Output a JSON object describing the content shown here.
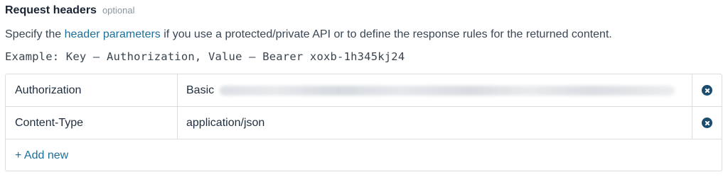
{
  "section": {
    "title": "Request headers",
    "optional_label": "optional"
  },
  "description": {
    "prefix": "Specify the ",
    "link_text": "header parameters",
    "suffix": " if you use a protected/private API or to define the response rules for the returned content."
  },
  "example_text": "Example: Key – Authorization, Value – Bearer xoxb-1h345kj24",
  "headers": [
    {
      "key": "Authorization",
      "value": "Basic",
      "value_redacted": true
    },
    {
      "key": "Content-Type",
      "value": "application/json",
      "value_redacted": false
    }
  ],
  "actions": {
    "remove_icon": "close-circle-icon",
    "add_new_label": "+ Add new"
  },
  "colors": {
    "link": "#1d6f99",
    "remove_icon": "#1c4d6e",
    "border": "#d9dee3"
  }
}
